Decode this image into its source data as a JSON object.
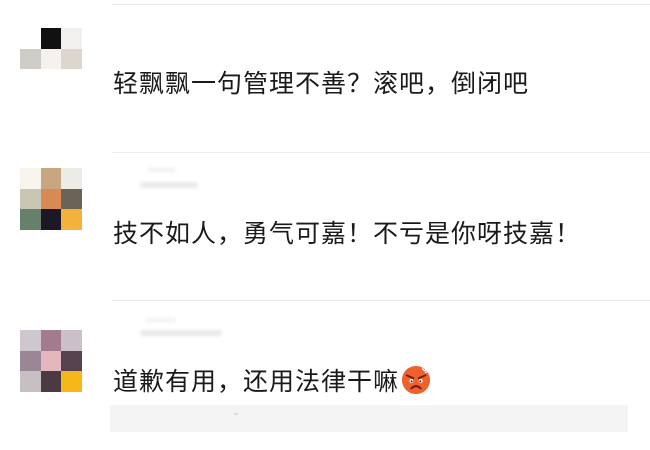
{
  "comments": [
    {
      "text": "轻飘飘一句管理不善？滚吧，倒闭吧",
      "avatar_colors": [
        "#ffffff",
        "#111111",
        "#f2f0ee",
        "#cfcbc6",
        "#f4f1ee",
        "#ddd6cf",
        "#ffffff",
        "#ffffff",
        "#ffffff"
      ]
    },
    {
      "text": "技不如人，勇气可嘉！不亏是你呀技嘉！",
      "avatar_colors": [
        "#f7f5ee",
        "#c7a782",
        "#ecebe6",
        "#c9c6b4",
        "#d98a52",
        "#6c6358",
        "#66806c",
        "#1d1826",
        "#f3b33a"
      ]
    },
    {
      "text": "道歉有用，还用法律干嘛",
      "emoji_name": "angry-face-icon",
      "avatar_colors": [
        "#cfc7cd",
        "#a27c8e",
        "#cbbfc8",
        "#9a8694",
        "#e4b7bf",
        "#57424f",
        "#c8bfc4",
        "#4a3a42",
        "#f6b71a"
      ]
    }
  ],
  "colors": {
    "text": "#1a1a1a",
    "divider": "#ececec",
    "reply_bg": "#f4f4f4"
  }
}
